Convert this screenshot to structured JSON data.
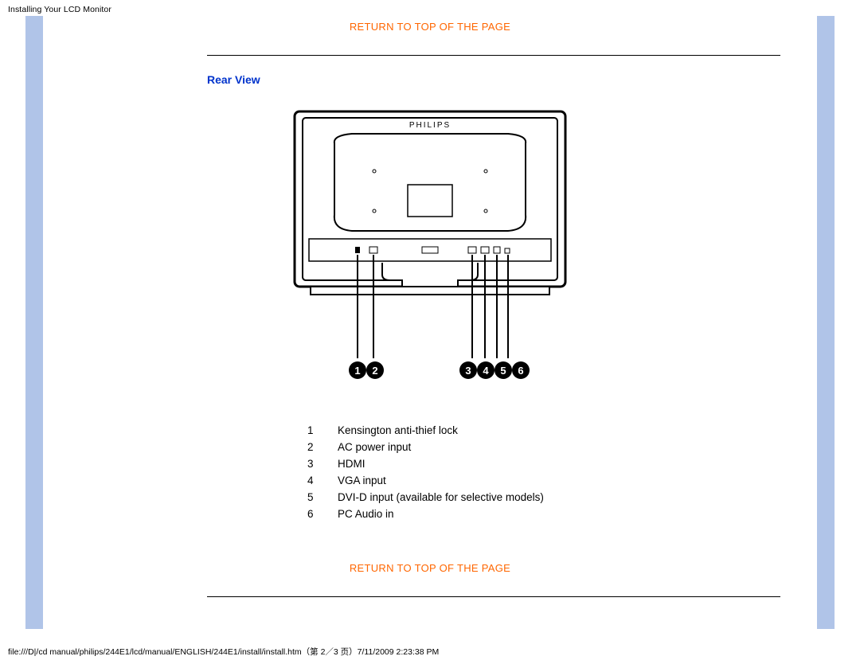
{
  "header": {
    "corner_title": "Installing Your LCD Monitor"
  },
  "links": {
    "return_top_1": "RETURN TO TOP OF THE PAGE",
    "return_top_2": "RETURN TO TOP OF THE PAGE"
  },
  "section": {
    "title": "Rear View"
  },
  "diagram": {
    "brand": "PHILIPS"
  },
  "ports": [
    {
      "num": "1",
      "label": "Kensington anti-thief lock"
    },
    {
      "num": "2",
      "label": "AC power input"
    },
    {
      "num": "3",
      "label": "HDMI"
    },
    {
      "num": "4",
      "label": "VGA input"
    },
    {
      "num": "5",
      "label": "DVI-D input (available for selective models)"
    },
    {
      "num": "6",
      "label": "PC Audio in"
    }
  ],
  "footer": {
    "path": "file:///D|/cd manual/philips/244E1/lcd/manual/ENGLISH/244E1/install/install.htm（第 2／3 页）7/11/2009 2:23:38 PM"
  }
}
